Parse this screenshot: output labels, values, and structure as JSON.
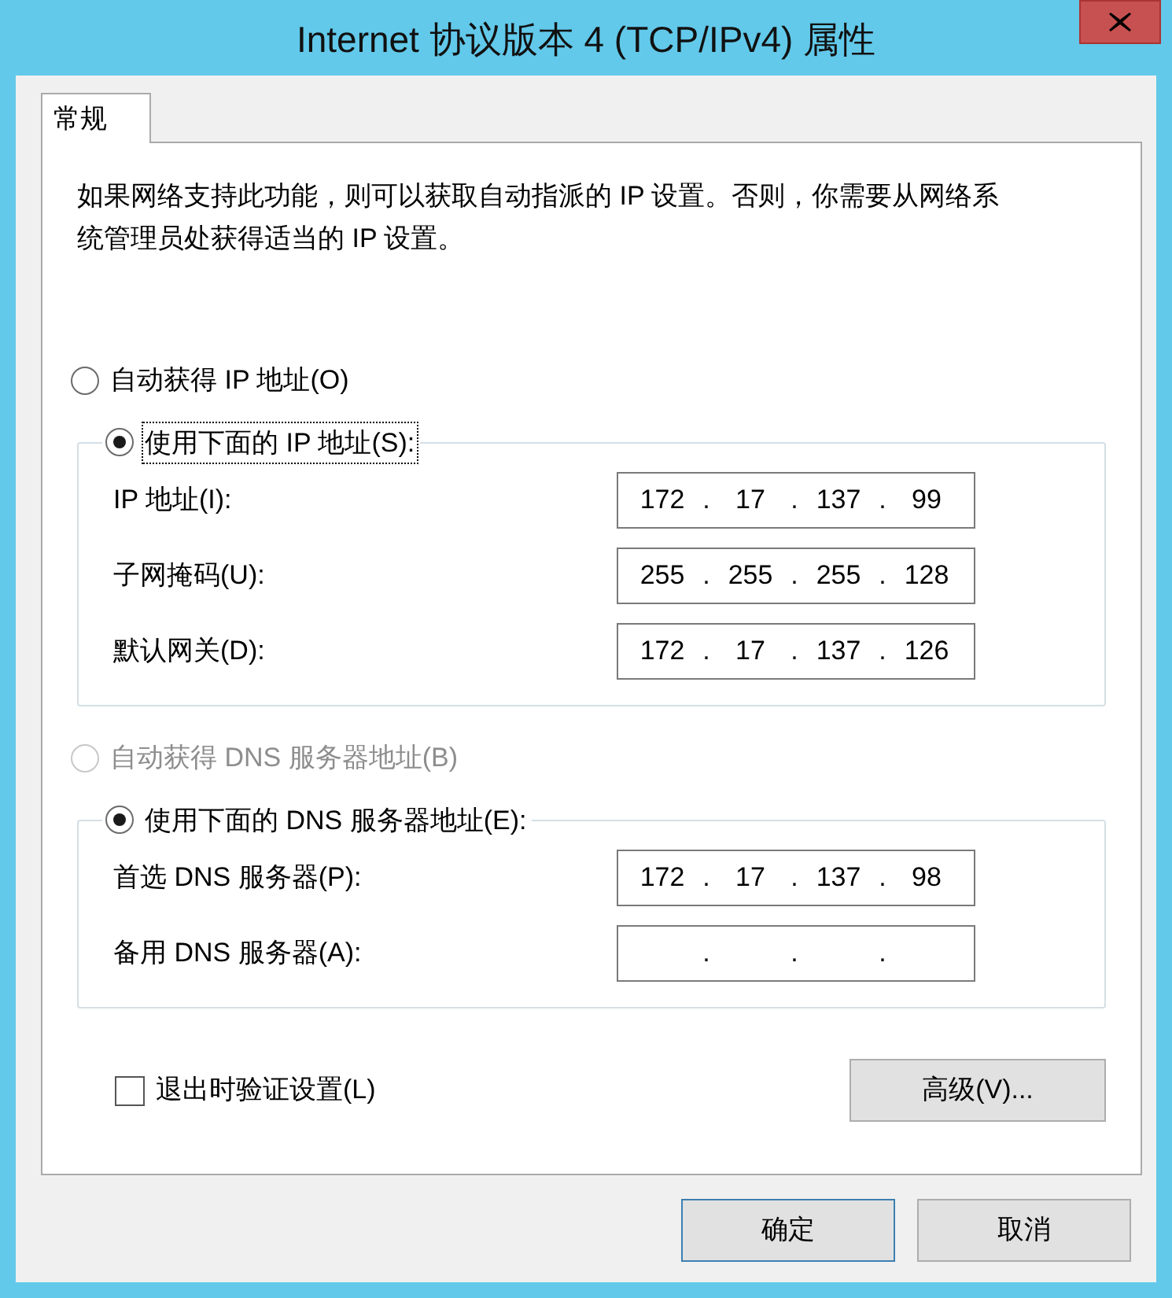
{
  "window": {
    "title": "Internet 协议版本 4 (TCP/IPv4) 属性"
  },
  "tabs": [
    {
      "label": "常规",
      "selected": true
    }
  ],
  "description": "如果网络支持此功能，则可以获取自动指派的 IP 设置。否则，你需要从网络系统管理员处获得适当的 IP 设置。",
  "octet_separator": ".",
  "ip_section": {
    "options": [
      {
        "label": "自动获得 IP 地址(O)",
        "selected": false,
        "disabled": false,
        "focused": false
      },
      {
        "label": "使用下面的 IP 地址(S):",
        "selected": true,
        "disabled": false,
        "focused": true
      }
    ],
    "fields": [
      {
        "label": "IP 地址(I):",
        "octets": [
          "172",
          "17",
          "137",
          "99"
        ]
      },
      {
        "label": "子网掩码(U):",
        "octets": [
          "255",
          "255",
          "255",
          "128"
        ]
      },
      {
        "label": "默认网关(D):",
        "octets": [
          "172",
          "17",
          "137",
          "126"
        ]
      }
    ]
  },
  "dns_section": {
    "options": [
      {
        "label": "自动获得 DNS 服务器地址(B)",
        "selected": false,
        "disabled": true,
        "focused": false
      },
      {
        "label": "使用下面的 DNS 服务器地址(E):",
        "selected": true,
        "disabled": false,
        "focused": false
      }
    ],
    "fields": [
      {
        "label": "首选 DNS 服务器(P):",
        "octets": [
          "172",
          "17",
          "137",
          "98"
        ]
      },
      {
        "label": "备用 DNS 服务器(A):"
      }
    ]
  },
  "validate_on_exit": {
    "label": "退出时验证设置(L)",
    "checked": false
  },
  "advanced_button": "高级(V)...",
  "buttons": [
    {
      "label": "确定",
      "default": true
    },
    {
      "label": "取消",
      "default": false
    }
  ]
}
